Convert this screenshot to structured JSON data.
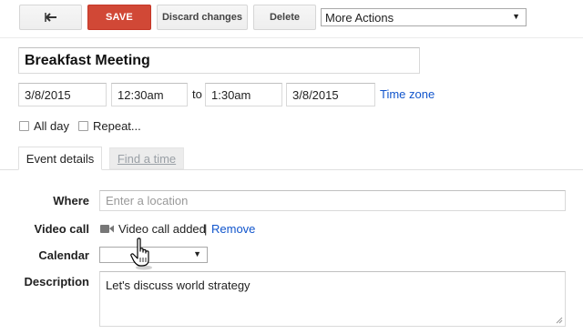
{
  "toolbar": {
    "back_icon": "back-arrow-icon",
    "save_label": "SAVE",
    "discard_label": "Discard changes",
    "delete_label": "Delete",
    "more_actions_value": "More Actions"
  },
  "event": {
    "title": "Breakfast Meeting",
    "start_date": "3/8/2015",
    "start_time": "12:30am",
    "to_label": "to",
    "end_time": "1:30am",
    "end_date": "3/8/2015",
    "time_zone_link": "Time zone",
    "all_day_label": "All day",
    "repeat_label": "Repeat..."
  },
  "tabs": [
    {
      "label": "Event details",
      "active": true
    },
    {
      "label": "Find a time",
      "active": false
    }
  ],
  "details": {
    "where_label": "Where",
    "where_placeholder": "Enter a location",
    "video_call_label": "Video call",
    "video_call_icon": "video-camera-icon",
    "video_call_status": "Video call added",
    "separator": "|",
    "remove_link": "Remove",
    "calendar_label": "Calendar",
    "calendar_value": "",
    "description_label": "Description",
    "description_value": "Let's discuss world strategy"
  },
  "colors": {
    "save_button": "#d14836",
    "link": "#1155cc",
    "tab_inactive_text": "#9aa0a6"
  }
}
